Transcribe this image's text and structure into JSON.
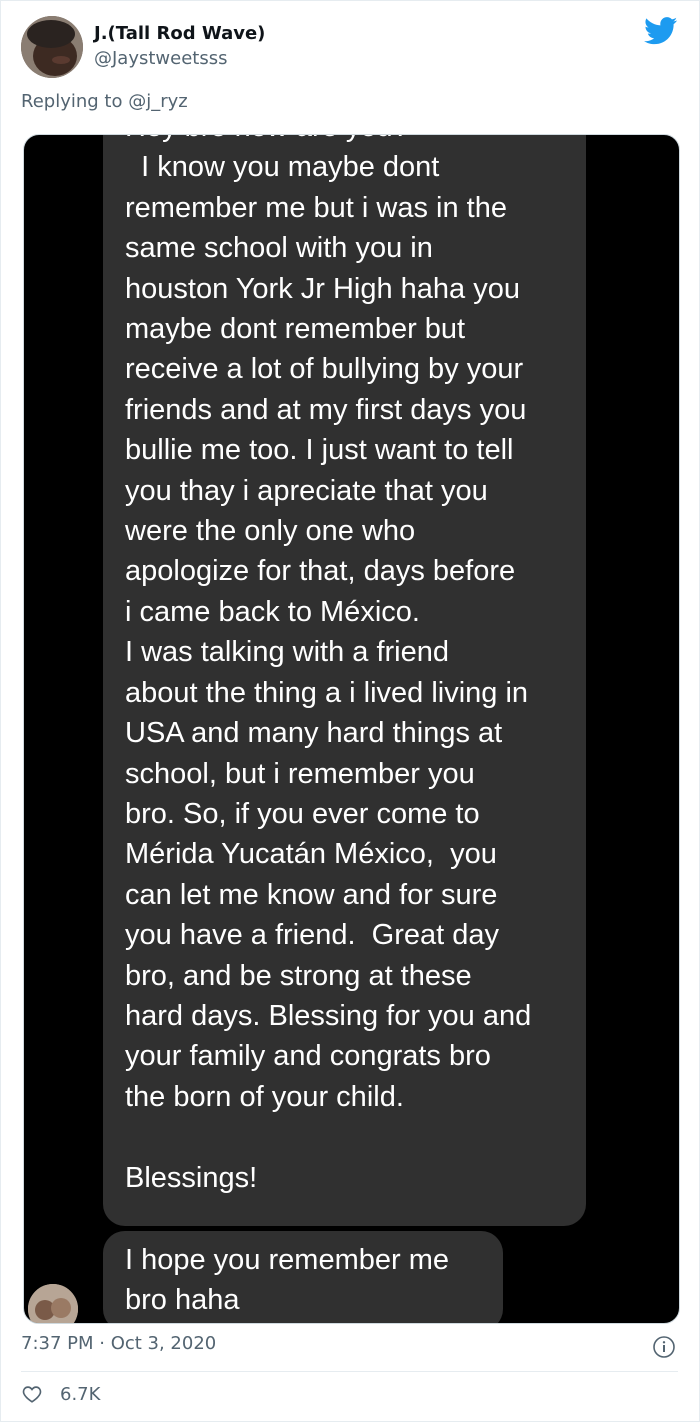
{
  "author": {
    "name": "J.(Tall Rod Wave)",
    "handle": "@Jaystweetsss"
  },
  "reply": {
    "prefix": "Replying to ",
    "to_handle": "@j_ryz"
  },
  "messages": {
    "main": "Hey bro now are you?\n  I know you maybe dont\nremember me but i was in the\nsame school with you in\nhouston York Jr High haha you\nmaybe dont remember but\nreceive a lot of bullying by your\nfriends and at my first days you\nbullie me too. I just want to tell\nyou thay i apreciate that you\nwere the only one who\napologize for that, days before\ni came back to México.\nI was talking with a friend\nabout the thing a i lived living in\nUSA and many hard things at\nschool, but i remember you\nbro. So, if you ever come to\nMérida Yucatán México,  you\ncan let me know and for sure\nyou have a friend.  Great day\nbro, and be strong at these\nhard days. Blessing for you and\nyour family and congrats bro\nthe born of your child.\n\nBlessings!",
    "followup": "I hope you remember me\nbro haha"
  },
  "meta": {
    "timestamp": "7:37 PM · Oct 3, 2020",
    "likes": "6.7K"
  },
  "icons": {
    "brand": "twitter-bird-icon",
    "info": "info-icon",
    "like": "heart-icon"
  },
  "colors": {
    "brand_blue": "#1d9bf0",
    "bubble": "#303030",
    "muted": "#536471"
  }
}
